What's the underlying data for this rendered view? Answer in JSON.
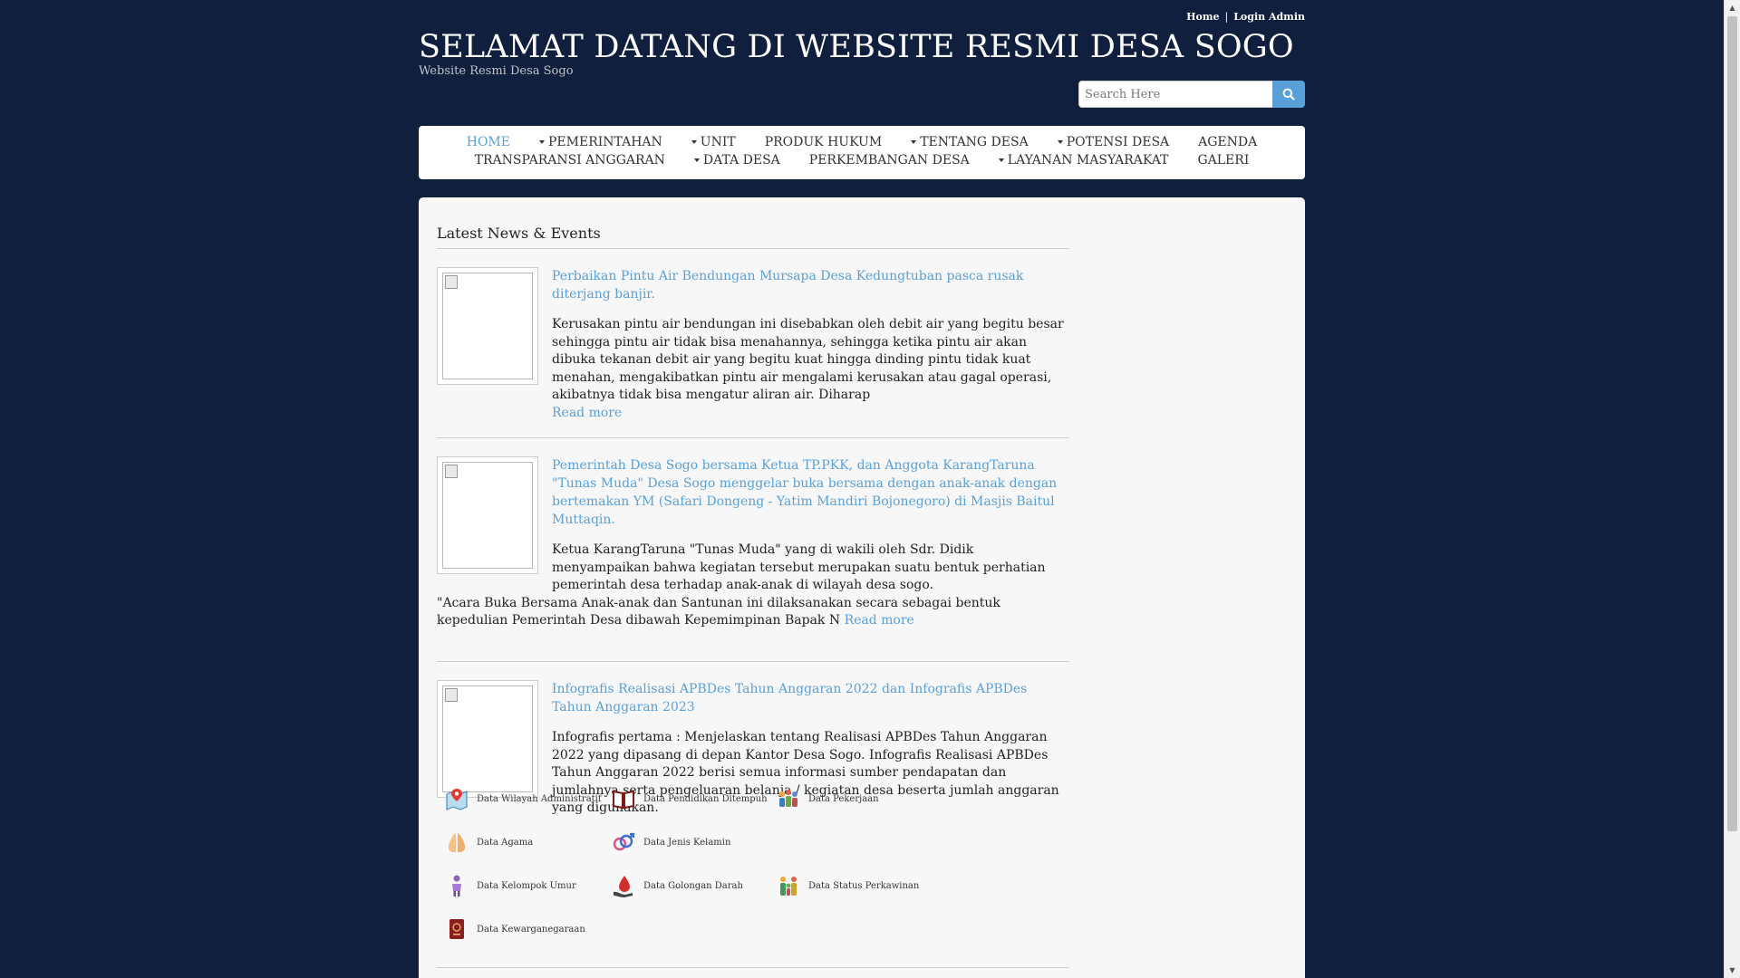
{
  "header": {
    "top_links": [
      "Home",
      "Login Admin"
    ],
    "title": "SELAMAT DATANG DI WEBSITE RESMI DESA SOGO",
    "subtitle": "Website Resmi Desa Sogo",
    "search_placeholder": "Search Here"
  },
  "nav": {
    "row1": [
      "HOME",
      "PEMERINTAHAN",
      "UNIT",
      "PRODUK HUKUM",
      "TENTANG DESA",
      "POTENSI DESA",
      "AGENDA"
    ],
    "row2": [
      "TRANSPARANSI ANGGARAN",
      "DATA DESA",
      "PERKEMBANGAN DESA",
      "LAYANAN MASYARAKAT",
      "GALERI"
    ]
  },
  "main": {
    "section_title": "Latest News & Events",
    "read_more": "Read more",
    "news": [
      {
        "title": "Perbaikan Pintu Air Bendungan Mursapa Desa Kedungtuban pasca rusak diterjang banjir.",
        "body": "Kerusakan pintu air bendungan ini disebabkan oleh debit air yang begitu besar sehingga pintu air tidak bisa menahannya, sehingga ketika pintu air akan dibuka tekanan debit air yang begitu kuat hingga dinding pintu tidak kuat menahan, mengakibatkan pintu air mengalami kerusakan atau gagal operasi, akibatnya tidak bisa mengatur aliran air. Diharap"
      },
      {
        "title": "Pemerintah Desa Sogo bersama Ketua TP.PKK, dan Anggota KarangTaruna \"Tunas Muda\" Desa Sogo menggelar buka bersama dengan anak-anak dengan bertemakan YM (Safari Dongeng - Yatim Mandiri Bojonegoro) di Masjis Baitul Muttaqin.",
        "body": "Ketua KarangTaruna \"Tunas Muda\" yang di wakili oleh Sdr. Didik menyampaikan bahwa kegiatan tersebut merupakan suatu bentuk perhatian pemerintah desa terhadap anak-anak di wilayah desa sogo.",
        "body2": "\"Acara Buka Bersama Anak-anak dan Santunan ini dilaksanakan secara sebagai bentuk kepedulian Pemerintah Desa dibawah Kepemimpinan Bapak N"
      },
      {
        "title": "Infografis Realisasi APBDes Tahun Anggaran 2022 dan Infografis APBDes Tahun Anggaran 2023",
        "body": "Infografis pertama : Menjelaskan tentang Realisasi APBDes Tahun Anggaran 2022 yang dipasang di depan Kantor Desa Sogo. Infografis Realisasi APBDes Tahun Anggaran 2022 berisi semua informasi sumber pendapatan dan jumlahnya serta pengeluaran belanja / kegiatan desa beserta jumlah anggaran yang digunakan."
      }
    ]
  },
  "data_links": [
    {
      "label": "Data Wilayah Administratif",
      "icon": "map-pin-icon"
    },
    {
      "label": "Data Pendidikan Ditempuh",
      "icon": "book-icon"
    },
    {
      "label": "Data Pekerjaan",
      "icon": "workers-icon"
    },
    {
      "label": "Data Agama",
      "icon": "praying-hands-icon"
    },
    {
      "label": "Data Jenis Kelamin",
      "icon": "gender-icon"
    },
    {
      "label": "Data Kelompok Umur",
      "icon": "person-age-icon"
    },
    {
      "label": "Data Golongan Darah",
      "icon": "blood-drop-icon"
    },
    {
      "label": "Data Status Perkawinan",
      "icon": "family-icon"
    },
    {
      "label": "Data Kewarganegaraan",
      "icon": "passport-icon"
    }
  ],
  "colors": {
    "background": "#0f1f3d",
    "accent": "#5aa0d8",
    "content_bg": "#f7f7f7"
  }
}
